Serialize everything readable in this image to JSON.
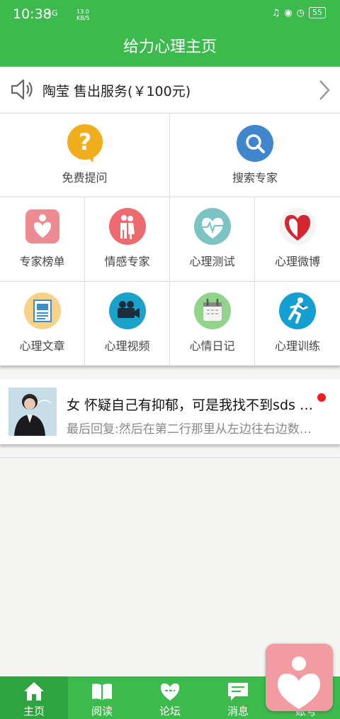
{
  "status": {
    "time": "10:38",
    "network": "4G",
    "speed_value": "13.0",
    "speed_unit": "KB/S",
    "battery": "55"
  },
  "header": {
    "title": "给力心理主页"
  },
  "notice": {
    "text": "陶莹 售出服务(￥100元)"
  },
  "grid": {
    "top": [
      {
        "label": "免费提问",
        "icon": "question-icon"
      },
      {
        "label": "搜索专家",
        "icon": "search-icon"
      }
    ],
    "row2": [
      {
        "label": "专家榜单",
        "icon": "heart-badge-icon"
      },
      {
        "label": "情感专家",
        "icon": "couple-icon"
      },
      {
        "label": "心理测试",
        "icon": "heartbeat-icon"
      },
      {
        "label": "心理微博",
        "icon": "heart-icon"
      }
    ],
    "row3": [
      {
        "label": "心理文章",
        "icon": "document-icon"
      },
      {
        "label": "心理视频",
        "icon": "video-camera-icon"
      },
      {
        "label": "心情日记",
        "icon": "calendar-icon"
      },
      {
        "label": "心理训练",
        "icon": "runner-icon"
      }
    ]
  },
  "post": {
    "title": "女 怀疑自己有抑郁，可是我找不到sds 测试在哪里",
    "reply": "最后回复:然后在第二行那里从左边往右边数第三个"
  },
  "tabs": [
    {
      "label": "主页",
      "icon": "home-icon"
    },
    {
      "label": "阅读",
      "icon": "book-icon"
    },
    {
      "label": "论坛",
      "icon": "forum-icon"
    },
    {
      "label": "消息",
      "icon": "message-icon"
    },
    {
      "label": "账号",
      "icon": "account-icon"
    }
  ],
  "colors": {
    "primary": "#3dba4e",
    "badge": "#f01e1e",
    "fab": "#f29ca1"
  }
}
